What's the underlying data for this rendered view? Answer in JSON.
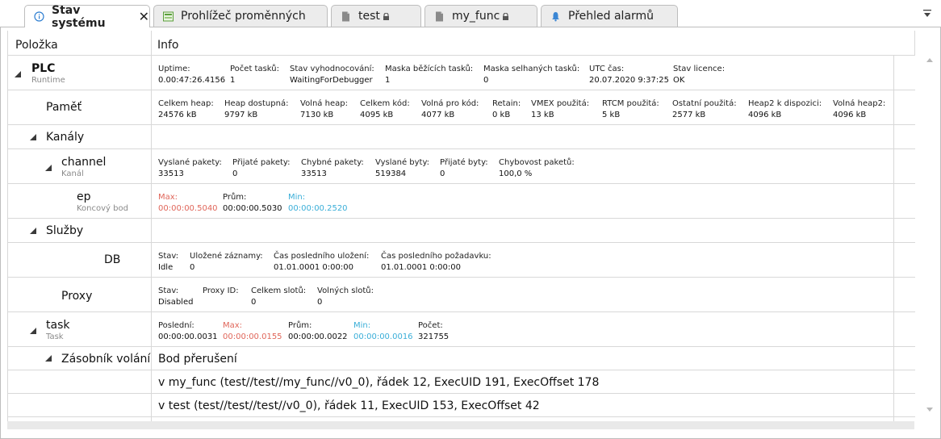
{
  "tabs": [
    {
      "label": "Stav systému",
      "icon": "info-icon",
      "active": true,
      "closable": true
    },
    {
      "label": "Prohlížeč proměnných",
      "icon": "variable-viewer-icon"
    },
    {
      "label": "test",
      "icon": "file-icon",
      "locked": true
    },
    {
      "label": "my_func",
      "icon": "file-icon",
      "locked": true
    },
    {
      "label": "Přehled alarmů",
      "icon": "bell-icon"
    }
  ],
  "columns": {
    "item": "Položka",
    "info": "Info"
  },
  "rows": {
    "plc": {
      "name": "PLC",
      "sub": "Runtime",
      "fields": [
        {
          "label": "Uptime:",
          "value": "0.00:47:26.4156"
        },
        {
          "label": "Počet tasků:",
          "value": "1"
        },
        {
          "label": "Stav vyhodnocování:",
          "value": "WaitingForDebugger"
        },
        {
          "label": "Maska běžících tasků:",
          "value": "1"
        },
        {
          "label": "Maska selhaných tasků:",
          "value": "0"
        },
        {
          "label": "UTC čas:",
          "value": "20.07.2020 9:37:25"
        },
        {
          "label": "Stav licence:",
          "value": "OK"
        }
      ]
    },
    "memory": {
      "name": "Paměť",
      "fields": [
        {
          "label": "Celkem heap:",
          "value": "24576 kB"
        },
        {
          "label": "Heap dostupná:",
          "value": "9797 kB"
        },
        {
          "label": "Volná heap:",
          "value": "7130 kB"
        },
        {
          "label": "Celkem kód:",
          "value": "4095 kB"
        },
        {
          "label": "Volná pro kód:",
          "value": "4077 kB"
        },
        {
          "label": "Retain:",
          "value": "0 kB"
        },
        {
          "label": "VMEX použitá:",
          "value": "13 kB"
        },
        {
          "label": "RTCM použitá:",
          "value": "5 kB"
        },
        {
          "label": "Ostatní použitá:",
          "value": "2577 kB"
        },
        {
          "label": "Heap2 k dispozici:",
          "value": "4096 kB"
        },
        {
          "label": "Volná heap2:",
          "value": "4096 kB"
        }
      ]
    },
    "channels": {
      "name": "Kanály"
    },
    "channel": {
      "name": "channel",
      "sub": "Kanál",
      "fields": [
        {
          "label": "Vyslané pakety:",
          "value": "33513"
        },
        {
          "label": "Přijaté pakety:",
          "value": "0"
        },
        {
          "label": "Chybné pakety:",
          "value": "33513"
        },
        {
          "label": "Vyslané byty:",
          "value": "519384"
        },
        {
          "label": "Přijaté byty:",
          "value": "0"
        },
        {
          "label": "Chybovost paketů:",
          "value": "100,0 %"
        }
      ]
    },
    "ep": {
      "name": "ep",
      "sub": "Koncový bod",
      "fields": [
        {
          "label": "Max:",
          "value": "00:00:00.5040"
        },
        {
          "label": "Prům:",
          "value": "00:00:00.5030"
        },
        {
          "label": "Min:",
          "value": "00:00:00.2520"
        }
      ]
    },
    "services": {
      "name": "Služby"
    },
    "db": {
      "name": "DB",
      "fields": [
        {
          "label": "Stav:",
          "value": "Idle"
        },
        {
          "label": "Uložené záznamy:",
          "value": "0"
        },
        {
          "label": "Čas posledního uložení:",
          "value": "01.01.0001 0:00:00"
        },
        {
          "label": "Čas posledního požadavku:",
          "value": "01.01.0001 0:00:00"
        }
      ]
    },
    "proxy": {
      "name": "Proxy",
      "fields": [
        {
          "label": "Stav:",
          "value": "Disabled"
        },
        {
          "label": "Proxy ID:",
          "value": ""
        },
        {
          "label": "Celkem slotů:",
          "value": "0"
        },
        {
          "label": "Volných slotů:",
          "value": "0"
        }
      ]
    },
    "task": {
      "name": "task",
      "sub": "Task",
      "fields": [
        {
          "label": "Poslední:",
          "value": "00:00:00.0031"
        },
        {
          "label": "Max:",
          "value": "00:00:00.0155"
        },
        {
          "label": "Prům:",
          "value": "00:00:00.0022"
        },
        {
          "label": "Min:",
          "value": "00:00:00.0016"
        },
        {
          "label": "Počet:",
          "value": "321755"
        }
      ]
    },
    "callstack": {
      "name": "Zásobník volání",
      "header": "Bod přerušení",
      "entries": [
        "v my_func (test//test//my_func//v0_0), řádek 12, ExecUID 191, ExecOffset 178",
        "v test (test//test//test//v0_0), řádek 11, ExecUID 153, ExecOffset 42"
      ]
    }
  },
  "colors": {
    "max": "#e0665a",
    "min": "#3aaed8"
  }
}
